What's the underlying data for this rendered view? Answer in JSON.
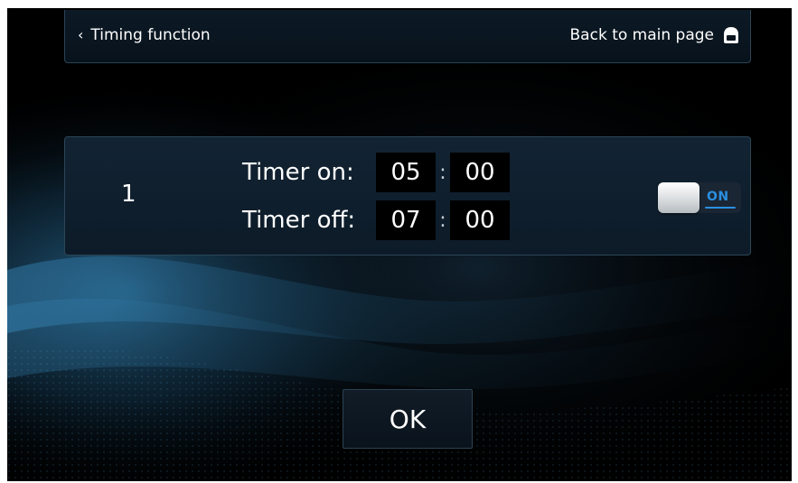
{
  "header": {
    "back_icon": "chevron-left-icon",
    "title": "Timing function",
    "back_to_main": "Back to main page",
    "home_icon": "home-icon"
  },
  "timer": {
    "index": "1",
    "on_label": "Timer on:",
    "on_hour": "05",
    "on_minute": "00",
    "off_label": "Timer off:",
    "off_hour": "07",
    "off_minute": "00",
    "separator": ":",
    "toggle_label": "ON",
    "toggle_state": true
  },
  "ok_label": "OK",
  "colors": {
    "accent": "#2a8fe0",
    "panel": "#122333",
    "background": "#000000"
  }
}
